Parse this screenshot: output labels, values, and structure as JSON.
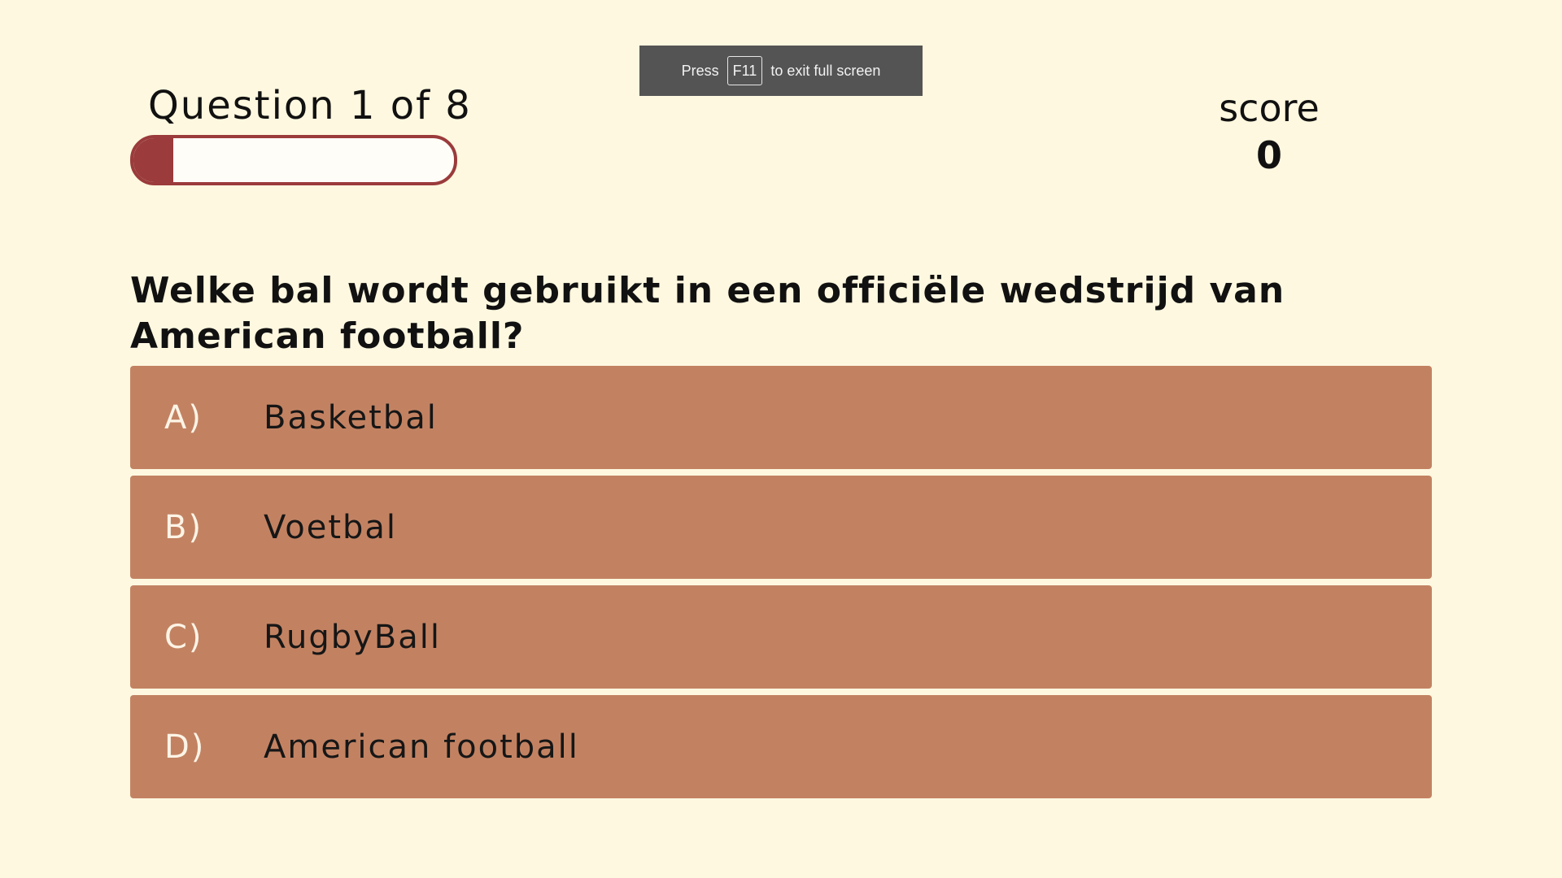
{
  "fullscreen_notice": {
    "prefix": "Press",
    "key": "F11",
    "suffix": "to exit full screen"
  },
  "hud": {
    "question_counter": "Question 1 of 8",
    "progress_fraction": 0.125,
    "score_label": "score",
    "score_value": "0"
  },
  "question": {
    "text": "Welke bal wordt gebruikt in een officiële wedstrijd van American football?"
  },
  "choices": [
    {
      "prefix": "A)",
      "text": "Basketbal"
    },
    {
      "prefix": "B)",
      "text": "Voetbal"
    },
    {
      "prefix": "C)",
      "text": "RugbyBall"
    },
    {
      "prefix": "D)",
      "text": "American football"
    }
  ],
  "colors": {
    "background": "#fff8e0",
    "choice_background": "#c28262",
    "progress_accent": "#9b3b3b"
  }
}
